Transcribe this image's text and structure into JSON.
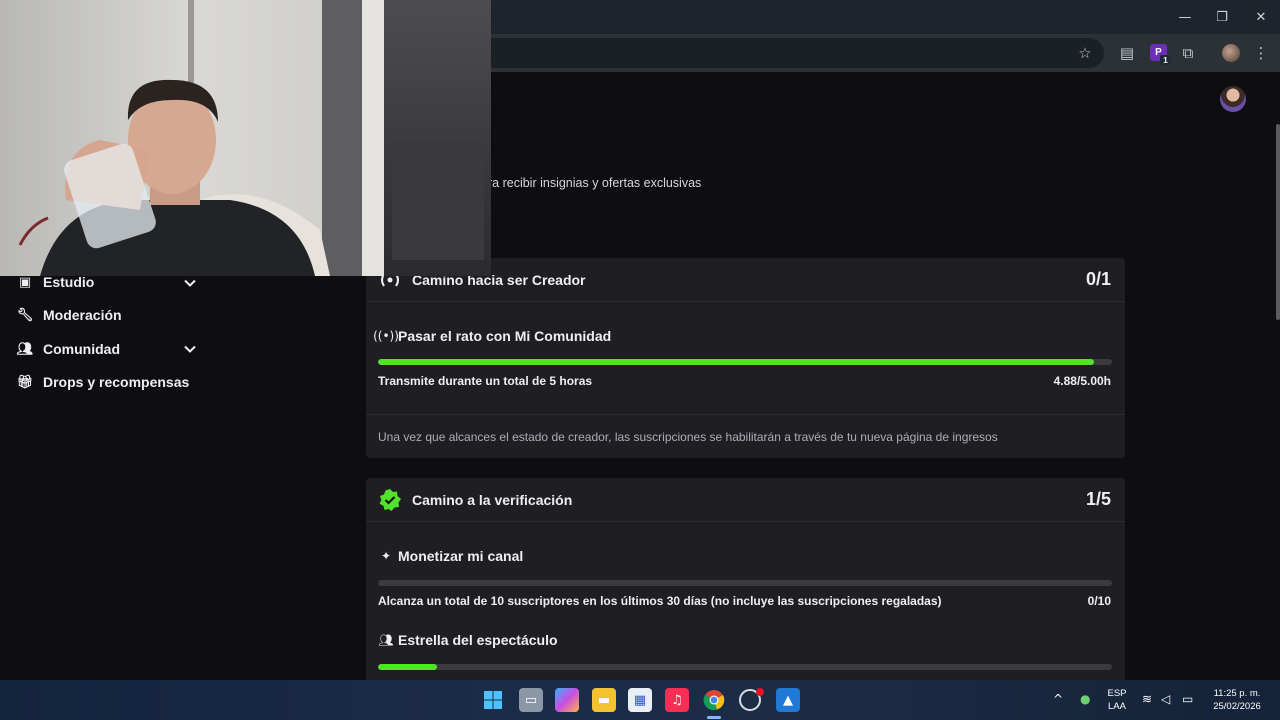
{
  "window": {
    "minimize_icon": "minimize-icon",
    "maximize_icon": "restore-icon",
    "close_icon": "close-icon"
  },
  "toolbar": {
    "bookmark_icon": "star-icon",
    "reading_icon": "document-icon",
    "extension_label": "P",
    "extension_badge": "1",
    "extensions_icon": "puzzle-icon",
    "menu_icon": "kebab-menu-icon"
  },
  "page": {
    "subtitle": "ra recibir insignias y ofertas exclusivas"
  },
  "sidebar": {
    "items": [
      {
        "label": "Estudio",
        "icon": "studio-icon",
        "has_chevron": true
      },
      {
        "label": "Moderación",
        "icon": "wrench-icon",
        "has_chevron": false
      },
      {
        "label": "Comunidad",
        "icon": "community-icon",
        "has_chevron": true
      },
      {
        "label": "Drops y recompensas",
        "icon": "gift-icon",
        "has_chevron": false
      }
    ]
  },
  "creator_card": {
    "title": "Camino hacia ser Creador",
    "count": "0/1",
    "task_title": "Pasar el rato con Mi Comunidad",
    "requirement": "Transmite durante un total de 5 horas",
    "progress_value": "4.88/5.00h",
    "progress_fraction": 0.976,
    "note": "Una vez que alcances el estado de creador, las suscripciones se habilitarán a través de tu nueva página de ingresos"
  },
  "verification_card": {
    "title": "Camino a la verificación",
    "count": "1/5",
    "task1_title": "Monetizar mi canal",
    "task1_requirement": "Alcanza un total de 10 suscriptores en los últimos 30 días (no incluye las suscripciones regaladas)",
    "task1_value": "0/10",
    "task1_fraction": 0,
    "task2_title": "Estrella del espectáculo",
    "task2_fraction": 0.08
  },
  "taskbar": {
    "language_line1": "ESP",
    "language_line2": "LAA",
    "time": "11:25 p. m.",
    "date": "25/02/2026"
  },
  "colors": {
    "accent_green": "#53e22c",
    "verify_green": "#53e22c"
  }
}
